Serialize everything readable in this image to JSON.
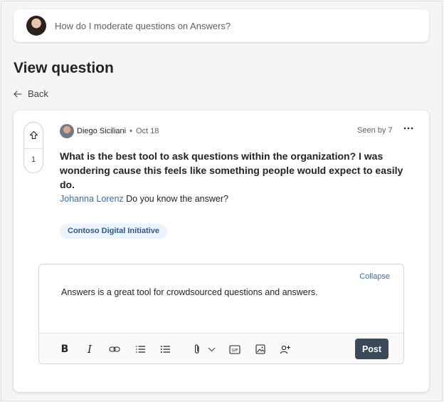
{
  "ask": {
    "placeholder": "How do I moderate questions on Answers?"
  },
  "page": {
    "title": "View question",
    "back_label": "Back"
  },
  "post": {
    "vote_count": "1",
    "author": "Diego Siciliani",
    "separator": "•",
    "date": "Oct 18",
    "seen_by": "Seen by 7",
    "question": "What is the best tool to ask questions within the organization? I was wondering cause this feels like something people would expect to easily do.",
    "mention_name": "Johanna Lorenz",
    "mention_text": " Do you know the answer?",
    "tag": "Contoso Digital Initiative"
  },
  "reply": {
    "collapse_label": "Collapse",
    "text": "Answers is a great tool for crowdsourced questions and answers.",
    "post_label": "Post",
    "toolbar_icons": [
      "bold-icon",
      "italic-icon",
      "link-icon",
      "numbered-list-icon",
      "bulleted-list-icon",
      "attach-icon",
      "chevron-down-icon",
      "gif-icon",
      "image-icon",
      "mention-people-icon"
    ]
  },
  "colors": {
    "accent_link": "#3b6cb7",
    "post_button": "#3a4a5a",
    "tag_bg": "#ebf3fc"
  }
}
